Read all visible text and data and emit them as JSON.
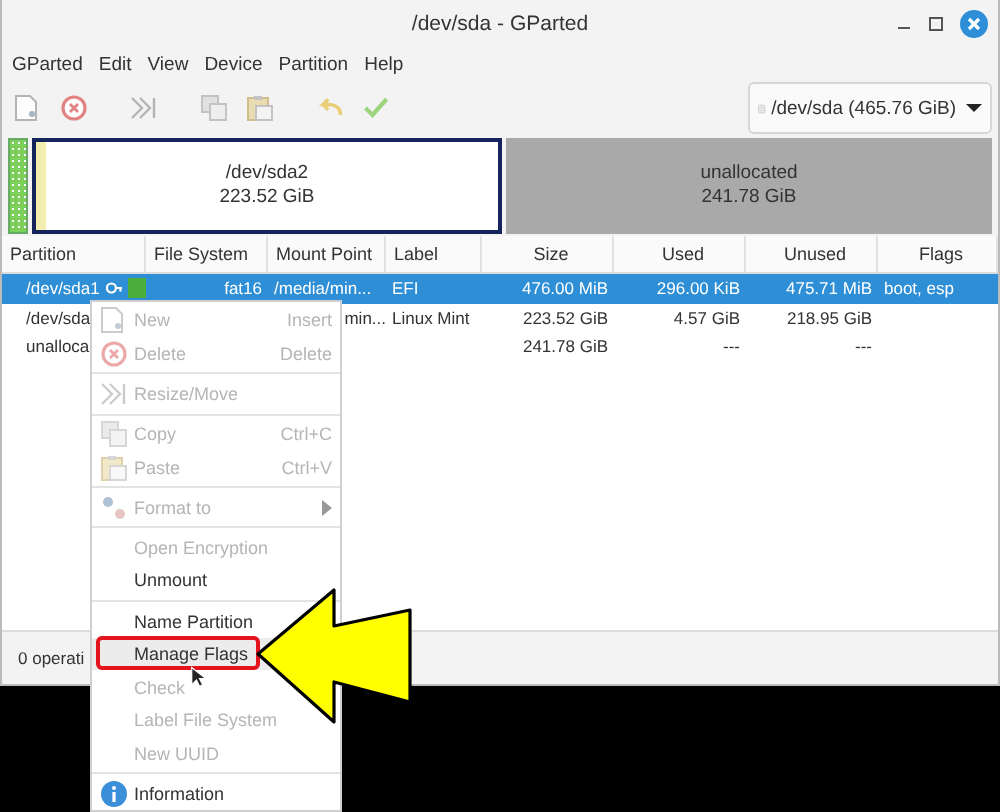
{
  "window": {
    "title": "/dev/sda - GParted"
  },
  "menubar": [
    "GParted",
    "Edit",
    "View",
    "Device",
    "Partition",
    "Help"
  ],
  "device_selector": {
    "value": "/dev/sda (465.76 GiB)"
  },
  "disk_map": [
    {
      "kind": "small",
      "color": "#7ccf5a"
    },
    {
      "kind": "partition",
      "name": "/dev/sda2",
      "size": "223.52 GiB",
      "selected": false
    },
    {
      "kind": "unallocated",
      "name": "unallocated",
      "size": "241.78 GiB",
      "selected": false
    }
  ],
  "table": {
    "columns": [
      "Partition",
      "File System",
      "Mount Point",
      "Label",
      "Size",
      "Used",
      "Unused",
      "Flags"
    ],
    "rows": [
      {
        "selected": true,
        "partition": "/dev/sda1",
        "locked": true,
        "color": "#4caf3c",
        "file_system": "fat16",
        "mount_point": "/media/min...",
        "label": "EFI",
        "size": "476.00 MiB",
        "used": "296.00 KiB",
        "unused": "475.71 MiB",
        "flags": "boot, esp"
      },
      {
        "selected": false,
        "partition": "/dev/sda",
        "mount_point": "min...",
        "label": "Linux Mint",
        "size": "223.52 GiB",
        "used": "4.57 GiB",
        "unused": "218.95 GiB"
      },
      {
        "selected": false,
        "partition": "unalloca",
        "size": "241.78 GiB",
        "used": "---",
        "unused": "---"
      }
    ]
  },
  "status_bar": "0 operati",
  "context_menu": [
    {
      "kind": "item",
      "label": "New",
      "shortcut": "Insert",
      "disabled": true,
      "selected": false
    },
    {
      "kind": "item",
      "label": "Delete",
      "shortcut": "Delete",
      "disabled": true,
      "selected": false
    },
    {
      "kind": "separator"
    },
    {
      "kind": "item",
      "label": "Resize/Move",
      "disabled": true,
      "selected": false
    },
    {
      "kind": "separator"
    },
    {
      "kind": "item",
      "label": "Copy",
      "shortcut": "Ctrl+C",
      "disabled": true,
      "selected": false
    },
    {
      "kind": "item",
      "label": "Paste",
      "shortcut": "Ctrl+V",
      "disabled": true,
      "selected": false
    },
    {
      "kind": "separator"
    },
    {
      "kind": "item",
      "label": "Format to",
      "submenu": true,
      "disabled": true,
      "selected": false
    },
    {
      "kind": "separator"
    },
    {
      "kind": "item",
      "label": "Open Encryption",
      "disabled": true,
      "selected": false
    },
    {
      "kind": "item",
      "label": "Unmount",
      "disabled": false,
      "selected": false
    },
    {
      "kind": "separator"
    },
    {
      "kind": "item",
      "label": "Name Partition",
      "disabled": false,
      "selected": false
    },
    {
      "kind": "item",
      "label": "Manage Flags",
      "disabled": false,
      "selected": true
    },
    {
      "kind": "item",
      "label": "Check",
      "disabled": true,
      "selected": false
    },
    {
      "kind": "item",
      "label": "Label File System",
      "disabled": true,
      "selected": false
    },
    {
      "kind": "item",
      "label": "New UUID",
      "disabled": true,
      "selected": false
    },
    {
      "kind": "separator"
    },
    {
      "kind": "item",
      "label": "Information",
      "disabled": false,
      "selected": false
    }
  ]
}
